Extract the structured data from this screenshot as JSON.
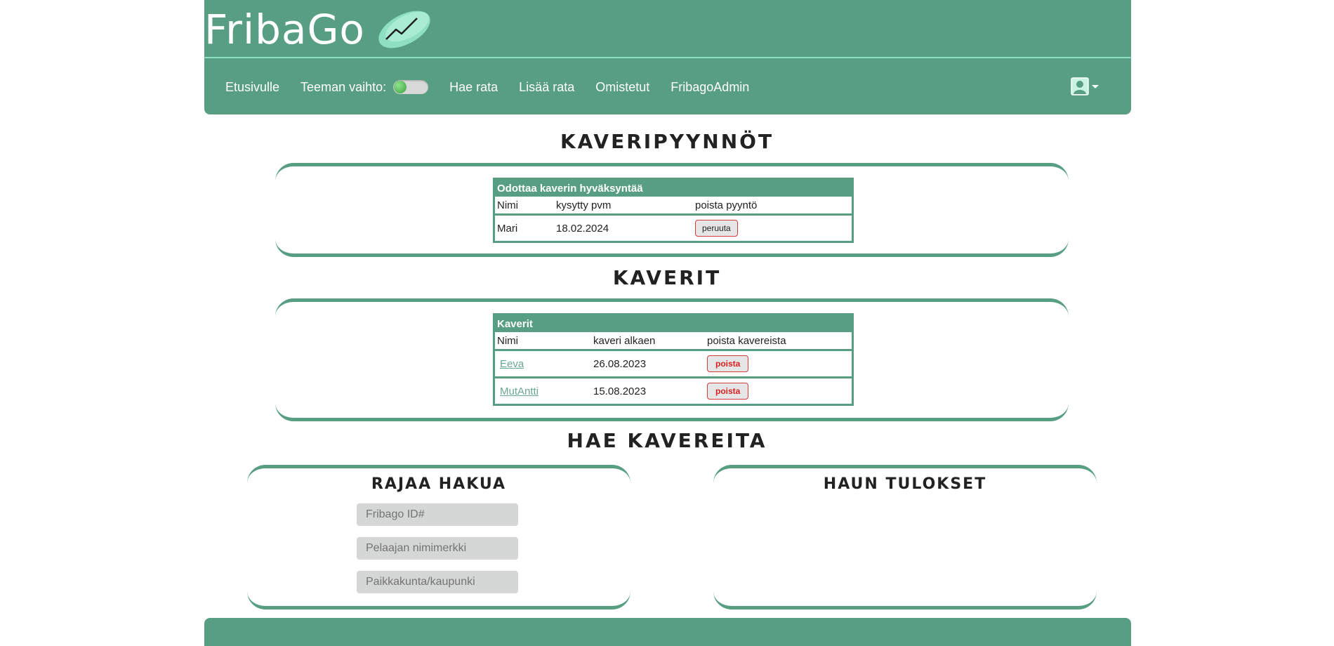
{
  "brand": {
    "name": "FribaGo"
  },
  "nav": {
    "home": "Etusivulle",
    "theme_label": "Teeman vaihto:",
    "find_course": "Hae rata",
    "add_course": "Lisää rata",
    "owned": "Omistetut",
    "admin": "FribagoAdmin"
  },
  "requests": {
    "title": "KAVERIPYYNNÖT",
    "caption": "Odottaa kaverin hyväksyntää",
    "col_name": "Nimi",
    "col_date": "kysytty pvm",
    "col_action": "poista pyyntö",
    "rows": [
      {
        "name": "Mari",
        "date": "18.02.2024",
        "action": "peruuta"
      }
    ]
  },
  "friends": {
    "title": "KAVERIT",
    "caption": "Kaverit",
    "col_name": "Nimi",
    "col_date": "kaveri alkaen",
    "col_action": "poista kavereista",
    "rows": [
      {
        "name": "Eeva",
        "date": "26.08.2023",
        "action": "poista"
      },
      {
        "name": "MutAntti",
        "date": "15.08.2023",
        "action": "poista"
      }
    ]
  },
  "search": {
    "title": "HAE KAVEREITA",
    "filter_title": "RAJAA HAKUA",
    "results_title": "HAUN TULOKSET",
    "id_placeholder": "Fribago ID#",
    "nick_placeholder": "Pelaajan nimimerkki",
    "city_placeholder": "Paikkakunta/kaupunki"
  },
  "colors": {
    "accent": "#579e82",
    "accent_light": "#8fe0c2",
    "danger": "#d43b3b"
  },
  "icons": {
    "logo": "frisbee-disc-icon",
    "user": "user-profile-icon",
    "caret": "chevron-down-icon"
  }
}
